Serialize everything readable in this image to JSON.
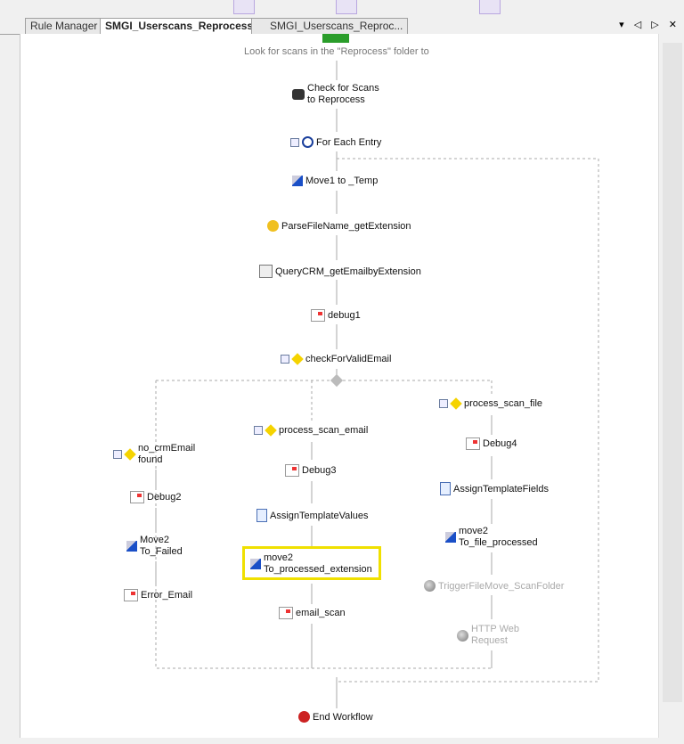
{
  "tabs": [
    {
      "label": "Rule Manager",
      "active": false
    },
    {
      "label": "SMGI_Userscans_Reprocess*",
      "active": true
    },
    {
      "label": "SMGI_Userscans_Reproc...",
      "active": false
    }
  ],
  "tab_controls": "▾ ◁ ▷ ✕",
  "workflow": {
    "start_caption": "Look for scans in the \"Reprocess\" folder to",
    "check": "Check for Scans\nto Reprocess",
    "foreach": "For Each Entry",
    "move1": "Move1 to _Temp",
    "parse": "ParseFileName_getExtension",
    "query": "QueryCRM_getEmailbyExtension",
    "debug1": "debug1",
    "check_email": "checkForValidEmail",
    "left": {
      "cond": "no_crmEmail\nfound",
      "debug": "Debug2",
      "move": "Move2\nTo_Failed",
      "email": "Error_Email"
    },
    "middle": {
      "cond": "process_scan_email",
      "debug": "Debug3",
      "assign": "AssignTemplateValues",
      "move": "move2\nTo_processed_extension",
      "email": "email_scan"
    },
    "right": {
      "cond": "process_scan_file",
      "debug": "Debug4",
      "assign": "AssignTemplateFields",
      "move": "move2\nTo_file_processed",
      "trigger": "TriggerFileMove_ScanFolder",
      "http": "HTTP Web\nRequest"
    },
    "end": "End Workflow"
  },
  "colors": {
    "highlight": "#f0e000",
    "disabled": "#aaaaaa"
  }
}
